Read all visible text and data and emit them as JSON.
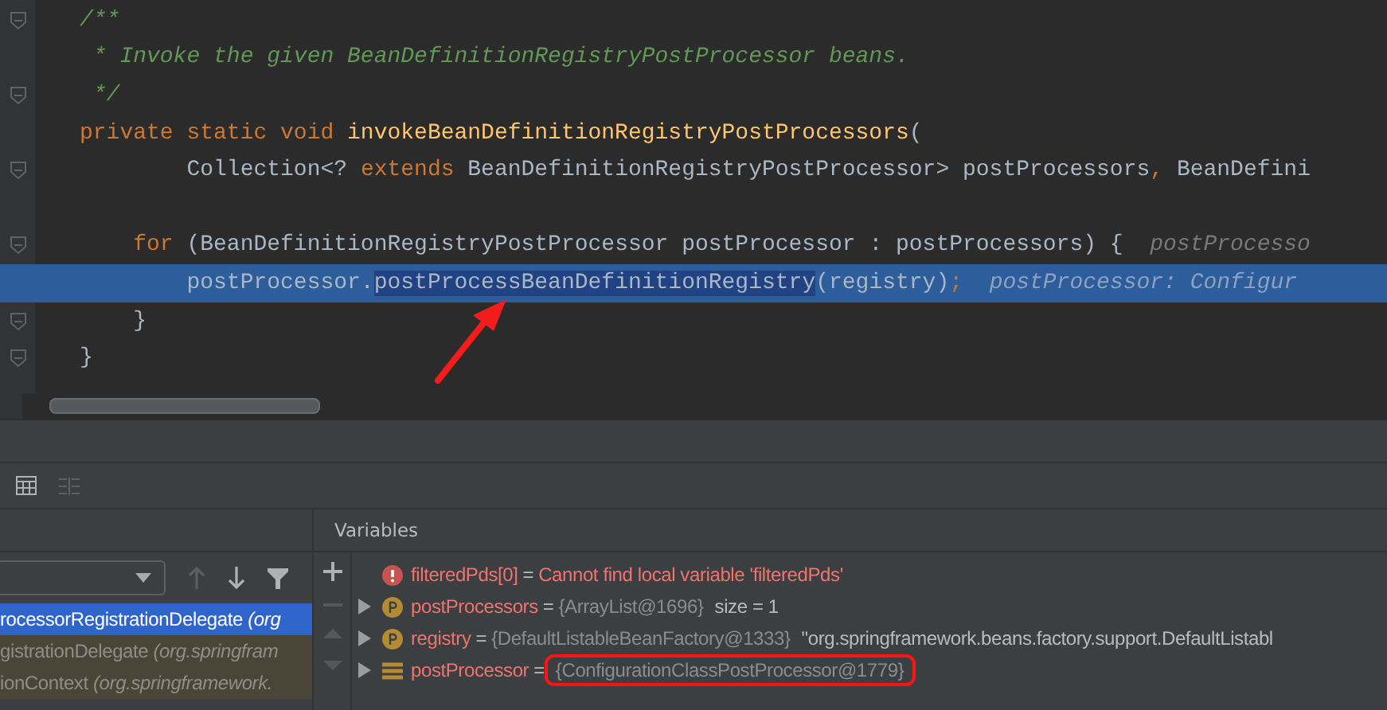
{
  "editor": {
    "lines": [
      {
        "current": false,
        "fold": true,
        "segments": [
          {
            "kind": "comment",
            "text": "/**"
          }
        ]
      },
      {
        "current": false,
        "fold": false,
        "segments": [
          {
            "kind": "comment",
            "text": " * Invoke the given BeanDefinitionRegistryPostProcessor beans."
          }
        ]
      },
      {
        "current": false,
        "fold": true,
        "segments": [
          {
            "kind": "comment",
            "text": " */"
          }
        ]
      },
      {
        "current": false,
        "fold": false,
        "segments": [
          {
            "kind": "keyword",
            "text": "private static void "
          },
          {
            "kind": "method",
            "text": "invokeBeanDefinitionRegistryPostProcessors"
          },
          {
            "kind": "plain",
            "text": "("
          }
        ]
      },
      {
        "current": false,
        "fold": true,
        "segments": [
          {
            "kind": "plain",
            "text": "        Collection<? "
          },
          {
            "kind": "keyword",
            "text": "extends "
          },
          {
            "kind": "plain",
            "text": "BeanDefinitionRegistryPostProcessor> postProcessors"
          },
          {
            "kind": "keyword",
            "text": ", "
          },
          {
            "kind": "plain",
            "text": "BeanDefini"
          }
        ]
      },
      {
        "current": false,
        "fold": false
      },
      {
        "current": false,
        "fold": true,
        "segments": [
          {
            "kind": "keyword",
            "text": "    for "
          },
          {
            "kind": "plain",
            "text": "(BeanDefinitionRegistryPostProcessor postProcessor : postProcessors) {  "
          },
          {
            "kind": "hint",
            "text": "postProcesso"
          }
        ]
      },
      {
        "current": true,
        "fold": false,
        "segments": [
          {
            "kind": "plain",
            "text": "        postProcessor."
          },
          {
            "kind": "selection",
            "text": "postProcessBeanDefinitionRegistry"
          },
          {
            "kind": "plain",
            "text": "(registry)"
          },
          {
            "kind": "keyword",
            "text": ";  "
          },
          {
            "kind": "hint",
            "text": "postProcessor: Configur"
          }
        ]
      },
      {
        "current": false,
        "fold": true,
        "segments": [
          {
            "kind": "plain",
            "text": "    }"
          }
        ]
      },
      {
        "current": false,
        "fold": true,
        "segments": [
          {
            "kind": "plain",
            "text": "}"
          }
        ]
      }
    ]
  },
  "frames": {
    "rows": [
      {
        "selected": true,
        "method": "rocessorRegistrationDelegate",
        "location": "(org"
      },
      {
        "selected": false,
        "method": "gistrationDelegate",
        "location": "(org.springfram"
      },
      {
        "selected": false,
        "method": "ionContext",
        "location": "(org.springframework."
      }
    ]
  },
  "variables": {
    "title": "Variables",
    "rows": [
      {
        "kind": "error",
        "expandable": false,
        "name": "filteredPds[0]",
        "eq": "=",
        "value": "Cannot find local variable 'filteredPds'",
        "extra": "",
        "boxed": false
      },
      {
        "kind": "field",
        "expandable": true,
        "name": "postProcessors",
        "eq": "=",
        "value": "{ArrayList@1696}",
        "extra": "size = 1",
        "boxed": false
      },
      {
        "kind": "field",
        "expandable": true,
        "name": "registry",
        "eq": "=",
        "value": "{DefaultListableBeanFactory@1333}",
        "extra": "\"org.springframework.beans.factory.support.DefaultListabl",
        "boxed": false
      },
      {
        "kind": "local",
        "expandable": true,
        "name": "postProcessor",
        "eq": "=",
        "value": "{ConfigurationClassPostProcessor@1779}",
        "extra": "",
        "boxed": true
      }
    ]
  }
}
